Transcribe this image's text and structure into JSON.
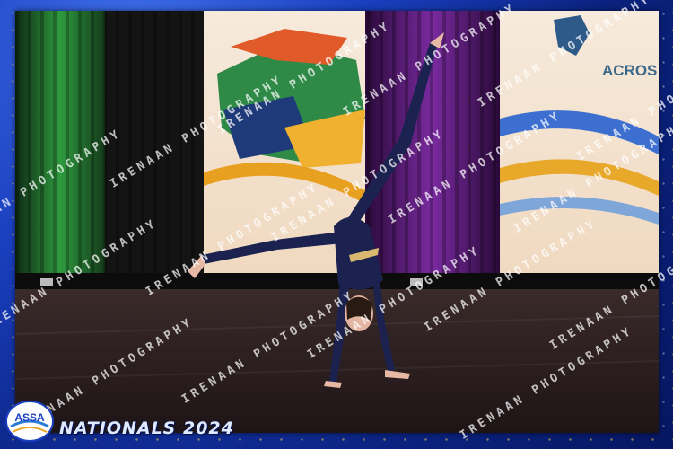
{
  "event": {
    "title": "NATIONALS 2024",
    "logo_text": "ASSA"
  },
  "backdrop": {
    "banner_text": "ACROS"
  },
  "watermark": {
    "text": "IRENAAN PHOTOGRAPHY"
  },
  "colors": {
    "frame_blue": "#1a3fbf",
    "curtain_green": "#2e8a3a",
    "curtain_purple": "#6a1f8a",
    "leotard": "#1b2250",
    "stage_floor": "#2b1f1f"
  }
}
